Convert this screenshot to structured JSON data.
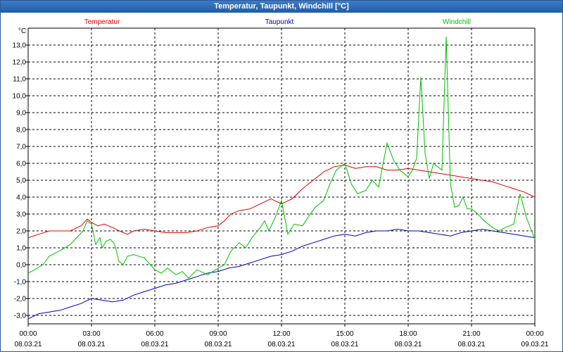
{
  "window": {
    "title": "Temperatur, Taupunkt, Windchill [°C]"
  },
  "chart_data": {
    "type": "line",
    "title": "Temperatur, Taupunkt, Windchill [°C]",
    "ylabel": "°C",
    "ylim": [
      -3.5,
      14.0
    ],
    "yticks": [
      -3.0,
      -2.0,
      -1.0,
      0.0,
      1.0,
      2.0,
      3.0,
      4.0,
      5.0,
      6.0,
      7.0,
      8.0,
      9.0,
      10.0,
      11.0,
      12.0,
      13.0
    ],
    "ytick_labels": [
      "-3,0",
      "-2,0",
      "-1,0",
      "0,0",
      "1,0",
      "2,0",
      "3,0",
      "4,0",
      "5,0",
      "6,0",
      "7,0",
      "8,0",
      "9,0",
      "10,0",
      "11,0",
      "12,0",
      "13,0"
    ],
    "xlim": [
      0,
      24
    ],
    "xticks": [
      {
        "time": "00:00",
        "date": "08.03.21"
      },
      {
        "time": "03:00",
        "date": "08.03.21"
      },
      {
        "time": "06:00",
        "date": "08.03.21"
      },
      {
        "time": "09:00",
        "date": "08.03.21"
      },
      {
        "time": "12:00",
        "date": "08.03.21"
      },
      {
        "time": "15:00",
        "date": "08.03.21"
      },
      {
        "time": "18:00",
        "date": "08.03.21"
      },
      {
        "time": "21:00",
        "date": "08.03.21"
      },
      {
        "time": "00:00",
        "date": "09.03.21"
      }
    ],
    "grid": true,
    "legend_position": "top",
    "series": [
      {
        "name": "Temperatur",
        "color": "#e00000",
        "x": [
          0,
          0.5,
          1,
          1.5,
          2,
          2.5,
          2.8,
          3,
          3.3,
          3.6,
          4,
          4.5,
          4.7,
          5,
          5.5,
          6,
          6.5,
          7,
          7.5,
          8,
          8.5,
          9,
          9.3,
          9.6,
          10,
          10.5,
          11,
          11.5,
          12,
          12.5,
          13,
          13.5,
          14,
          14.5,
          15,
          15.5,
          16,
          16.5,
          17,
          17.5,
          18,
          18.5,
          19,
          19.5,
          20,
          20.5,
          21,
          21.5,
          22,
          22.5,
          23,
          23.5,
          24
        ],
        "values": [
          1.6,
          1.8,
          2.0,
          2.0,
          2.0,
          2.3,
          2.7,
          2.5,
          2.3,
          2.4,
          2.2,
          1.9,
          1.8,
          2.0,
          2.1,
          2.0,
          1.9,
          1.9,
          1.9,
          2.0,
          2.2,
          2.3,
          2.6,
          3.0,
          3.2,
          3.3,
          3.6,
          3.9,
          3.6,
          3.9,
          4.5,
          5.0,
          5.5,
          5.8,
          5.9,
          5.7,
          5.8,
          5.8,
          5.6,
          5.6,
          5.7,
          5.6,
          5.5,
          5.4,
          5.3,
          5.2,
          5.1,
          5.0,
          4.9,
          4.7,
          4.5,
          4.3,
          4.0
        ]
      },
      {
        "name": "Taupunkt",
        "color": "#0000c0",
        "x": [
          0,
          0.5,
          1,
          1.5,
          2,
          2.5,
          3,
          3.5,
          4,
          4.5,
          5,
          5.5,
          6,
          6.5,
          7,
          7.5,
          8,
          8.5,
          9,
          9.5,
          10,
          10.5,
          11,
          11.5,
          12,
          12.5,
          13,
          13.5,
          14,
          14.5,
          15,
          15.5,
          16,
          16.5,
          17,
          17.5,
          18,
          18.5,
          19,
          19.5,
          20,
          20.5,
          21,
          21.5,
          22,
          22.5,
          23,
          23.5,
          24
        ],
        "values": [
          -3.2,
          -2.9,
          -2.8,
          -2.7,
          -2.5,
          -2.3,
          -2.0,
          -2.1,
          -2.2,
          -2.1,
          -1.8,
          -1.6,
          -1.4,
          -1.2,
          -1.1,
          -0.9,
          -0.7,
          -0.5,
          -0.4,
          -0.2,
          -0.1,
          0.1,
          0.3,
          0.5,
          0.6,
          0.8,
          1.1,
          1.3,
          1.5,
          1.7,
          1.8,
          1.7,
          1.9,
          2.0,
          2.0,
          2.1,
          2.0,
          2.0,
          1.9,
          1.8,
          1.7,
          1.9,
          2.0,
          2.1,
          2.0,
          1.9,
          1.8,
          1.7,
          1.6
        ]
      },
      {
        "name": "Windchill",
        "color": "#00c000",
        "x": [
          0,
          0.3,
          0.7,
          1,
          1.3,
          1.6,
          2,
          2.3,
          2.6,
          2.8,
          3,
          3.2,
          3.4,
          3.5,
          3.7,
          3.9,
          4.1,
          4.3,
          4.5,
          4.7,
          5,
          5.5,
          6,
          6.3,
          6.6,
          7,
          7.3,
          7.6,
          8,
          8.5,
          9,
          9.3,
          9.6,
          10,
          10.3,
          10.6,
          11,
          11.2,
          11.4,
          11.7,
          12,
          12.3,
          12.6,
          13,
          13.3,
          13.6,
          14,
          14.3,
          14.6,
          15,
          15.3,
          15.6,
          16,
          16.3,
          16.6,
          17,
          17.3,
          17.6,
          18,
          18.2,
          18.4,
          18.6,
          18.8,
          19,
          19.2,
          19.4,
          19.6,
          19.8,
          20,
          20.2,
          20.4,
          20.6,
          20.8,
          21,
          21.3,
          21.6,
          22,
          22.3,
          22.6,
          23,
          23.3,
          23.6,
          24
        ],
        "values": [
          -0.5,
          -0.3,
          0.0,
          0.5,
          0.7,
          0.9,
          1.2,
          1.6,
          2.0,
          2.6,
          2.4,
          1.2,
          1.6,
          1.0,
          1.4,
          1.5,
          1.2,
          0.2,
          0.0,
          0.5,
          0.6,
          0.4,
          -0.3,
          -0.5,
          -0.2,
          -0.6,
          -0.4,
          -0.8,
          -0.3,
          -0.6,
          -0.2,
          0.0,
          0.8,
          1.3,
          1.0,
          1.6,
          2.2,
          2.6,
          2.0,
          2.8,
          3.8,
          1.8,
          2.4,
          2.3,
          2.9,
          3.4,
          3.8,
          4.8,
          5.6,
          6.0,
          4.8,
          4.2,
          4.4,
          5.0,
          4.6,
          7.2,
          6.2,
          5.6,
          5.2,
          5.6,
          6.3,
          11.1,
          6.6,
          5.1,
          6.0,
          5.8,
          5.6,
          13.5,
          4.8,
          3.4,
          3.5,
          4.0,
          3.3,
          3.3,
          3.0,
          2.6,
          2.2,
          2.0,
          2.2,
          2.4,
          4.2,
          2.8,
          1.5
        ]
      }
    ]
  }
}
